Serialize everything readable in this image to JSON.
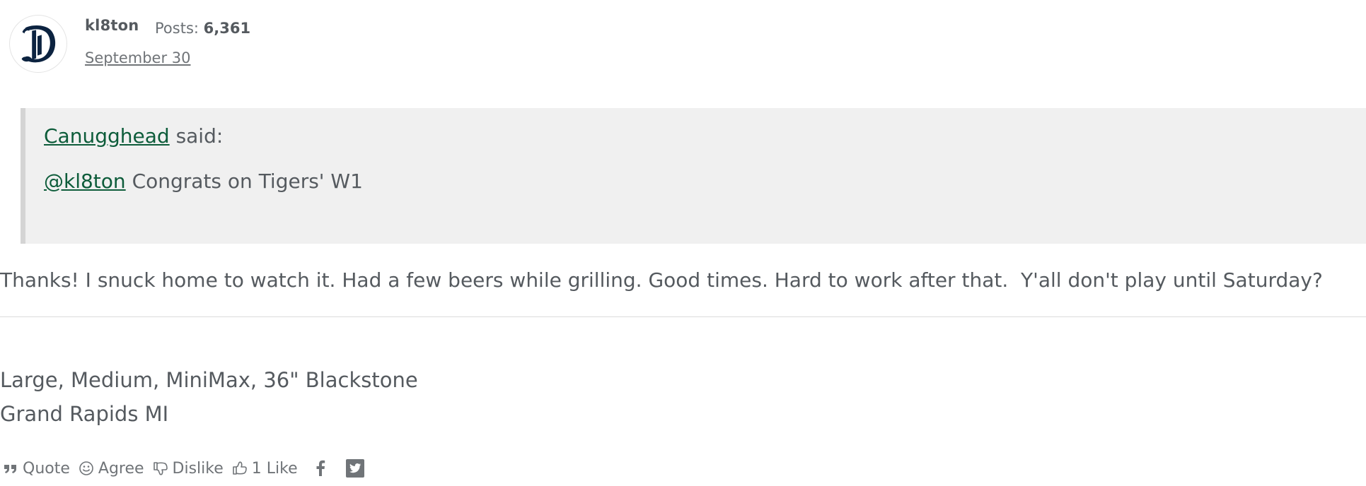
{
  "author": {
    "name": "kl8ton",
    "posts_label": "Posts:",
    "posts_count": "6,361",
    "date": "September 30",
    "avatar_icon": "detroit-tigers-d-logo"
  },
  "quote": {
    "author": "Canugghead",
    "said_label": "said:",
    "mention": "@kl8ton",
    "text": " Congrats on Tigers' W1"
  },
  "body": {
    "text": "Thanks! I snuck home to watch it. Had a few beers while grilling. Good times. Hard to work after that.  Y'all don't play until Saturday?"
  },
  "signature": {
    "lines": [
      "Large, Medium, MiniMax, 36\" Blackstone",
      "Grand Rapids MI"
    ]
  },
  "actions": {
    "quote_label": "Quote",
    "agree_label": "Agree",
    "dislike_label": "Dislike",
    "like_label": "1 Like",
    "share_icons": [
      "facebook-icon",
      "twitter-icon"
    ]
  },
  "colors": {
    "link": "#0d5c3a",
    "text": "#555a5f",
    "quote_bg": "#f0f0f0",
    "quote_border": "#d4d4d4",
    "logo": "#0c2340"
  }
}
